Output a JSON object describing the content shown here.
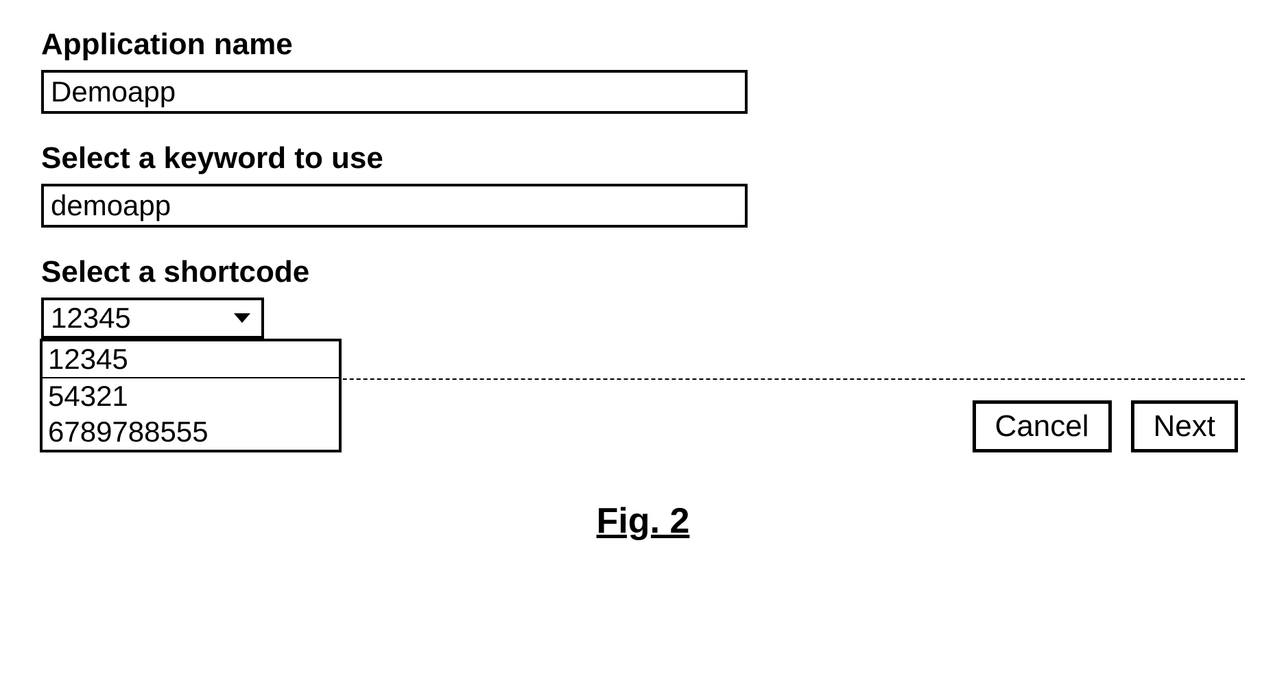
{
  "form": {
    "app_name": {
      "label": "Application name",
      "value": "Demoapp"
    },
    "keyword": {
      "label": "Select a keyword to use",
      "value": "demoapp"
    },
    "shortcode": {
      "label": "Select a shortcode",
      "selected": "12345",
      "options": [
        "12345",
        "54321",
        "6789788555"
      ]
    },
    "buttons": {
      "cancel": "Cancel",
      "next": "Next"
    }
  },
  "figure_label": "Fig. 2"
}
